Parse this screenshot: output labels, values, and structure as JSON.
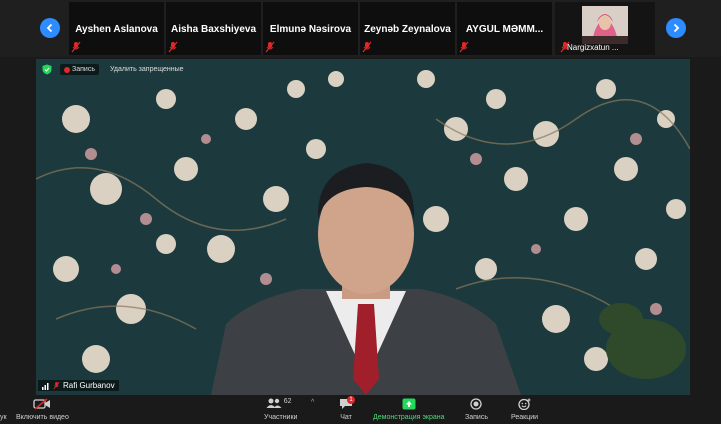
{
  "participants": [
    {
      "name": "Ayshen Aslanova"
    },
    {
      "name": "Aisha Baxshiyeva"
    },
    {
      "name": "Elmunə Nəsirova"
    },
    {
      "name": "Zeynəb Zeynalova"
    },
    {
      "name": "AYGÜL  MƏMM..."
    },
    {
      "name": "Nargizxatun ..."
    }
  ],
  "video": {
    "recording_label": "Запись",
    "remote_control_label": "Удалить запрещенные",
    "speaker_name": "Rafi Gurbanov"
  },
  "toolbar": {
    "left_label_fragment": "ук",
    "video_label": "Включить видео",
    "participants_label": "Участники",
    "participants_count": "62",
    "chat_label": "Чат",
    "chat_badge": "1",
    "share_label": "Демонстрация экрана",
    "record_label": "Запись",
    "reactions_label": "Реакции"
  },
  "colors": {
    "accent": "#2d8cff",
    "share_green": "#23d959",
    "alert_red": "#e02828",
    "share_label": "#4fd97a"
  }
}
